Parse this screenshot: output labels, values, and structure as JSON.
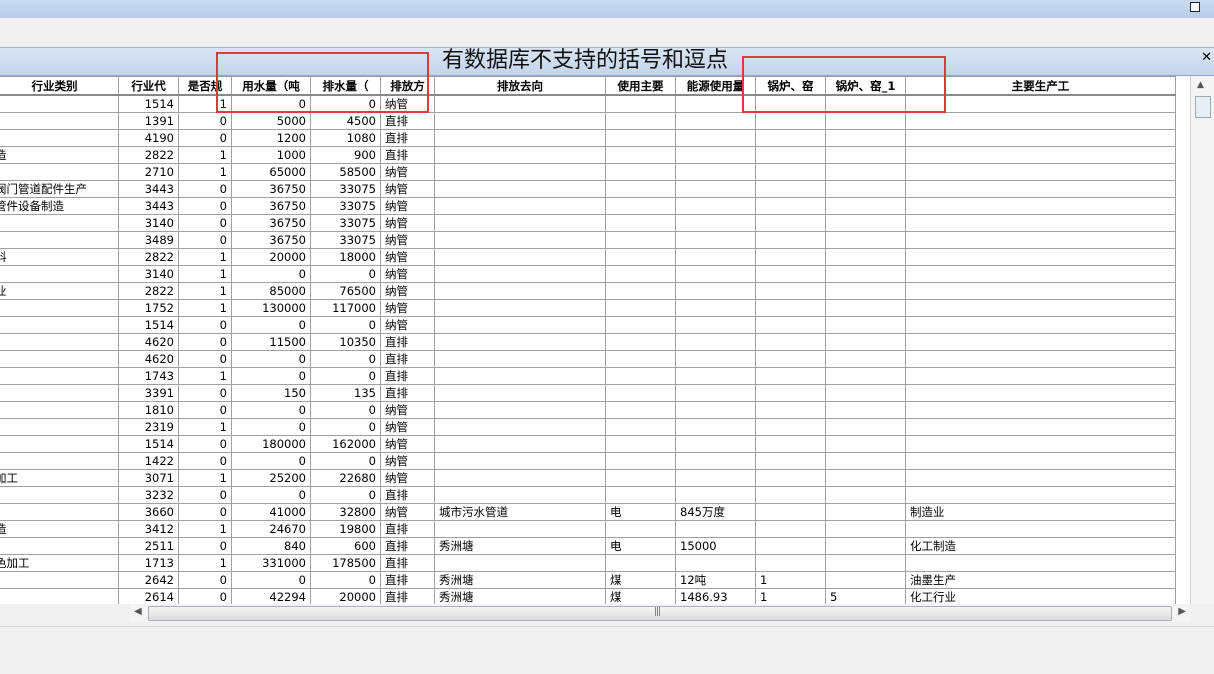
{
  "window": {
    "title": "有数据库不支持的括号和逗点"
  },
  "columns": [
    "行业类别",
    "行业代",
    "是否规",
    "用水量（吨",
    "排水量（",
    "排放方",
    "排放去向",
    "使用主要",
    "能源使用量",
    "锅炉、窑",
    "锅炉、窑_1",
    "主要生产工"
  ],
  "rows": [
    [
      "",
      "1514",
      "1",
      "0",
      "0",
      "纳管",
      "",
      "",
      "",
      "",
      "",
      ""
    ],
    [
      "",
      "1391",
      "0",
      "5000",
      "4500",
      "直排",
      "",
      "",
      "",
      "",
      "",
      ""
    ],
    [
      "",
      "4190",
      "0",
      "1200",
      "1080",
      "直排",
      "",
      "",
      "",
      "",
      "",
      ""
    ],
    [
      "造",
      "2822",
      "1",
      "1000",
      "900",
      "直排",
      "",
      "",
      "",
      "",
      "",
      ""
    ],
    [
      "",
      "2710",
      "1",
      "65000",
      "58500",
      "纳管",
      "",
      "",
      "",
      "",
      "",
      ""
    ],
    [
      "阀门管道配件生产",
      "3443",
      "0",
      "36750",
      "33075",
      "纳管",
      "",
      "",
      "",
      "",
      "",
      ""
    ],
    [
      "管件设备制造",
      "3443",
      "0",
      "36750",
      "33075",
      "纳管",
      "",
      "",
      "",
      "",
      "",
      ""
    ],
    [
      "",
      "3140",
      "0",
      "36750",
      "33075",
      "纳管",
      "",
      "",
      "",
      "",
      "",
      ""
    ],
    [
      "",
      "3489",
      "0",
      "36750",
      "33075",
      "纳管",
      "",
      "",
      "",
      "",
      "",
      ""
    ],
    [
      "料",
      "2822",
      "1",
      "20000",
      "18000",
      "纳管",
      "",
      "",
      "",
      "",
      "",
      ""
    ],
    [
      "",
      "3140",
      "1",
      "0",
      "0",
      "纳管",
      "",
      "",
      "",
      "",
      "",
      ""
    ],
    [
      "业",
      "2822",
      "1",
      "85000",
      "76500",
      "纳管",
      "",
      "",
      "",
      "",
      "",
      ""
    ],
    [
      "",
      "1752",
      "1",
      "130000",
      "117000",
      "纳管",
      "",
      "",
      "",
      "",
      "",
      ""
    ],
    [
      "",
      "1514",
      "0",
      "0",
      "0",
      "纳管",
      "",
      "",
      "",
      "",
      "",
      ""
    ],
    [
      "",
      "4620",
      "0",
      "11500",
      "10350",
      "直排",
      "",
      "",
      "",
      "",
      "",
      ""
    ],
    [
      "",
      "4620",
      "0",
      "0",
      "0",
      "直排",
      "",
      "",
      "",
      "",
      "",
      ""
    ],
    [
      "",
      "1743",
      "1",
      "0",
      "0",
      "直排",
      "",
      "",
      "",
      "",
      "",
      ""
    ],
    [
      "",
      "3391",
      "0",
      "150",
      "135",
      "直排",
      "",
      "",
      "",
      "",
      "",
      ""
    ],
    [
      "",
      "1810",
      "0",
      "0",
      "0",
      "纳管",
      "",
      "",
      "",
      "",
      "",
      ""
    ],
    [
      "",
      "2319",
      "1",
      "0",
      "0",
      "纳管",
      "",
      "",
      "",
      "",
      "",
      ""
    ],
    [
      "",
      "1514",
      "0",
      "180000",
      "162000",
      "纳管",
      "",
      "",
      "",
      "",
      "",
      ""
    ],
    [
      "",
      "1422",
      "0",
      "0",
      "0",
      "纳管",
      "",
      "",
      "",
      "",
      "",
      ""
    ],
    [
      "加工",
      "3071",
      "1",
      "25200",
      "22680",
      "纳管",
      "",
      "",
      "",
      "",
      "",
      ""
    ],
    [
      "",
      "3232",
      "0",
      "0",
      "0",
      "直排",
      "",
      "",
      "",
      "",
      "",
      ""
    ],
    [
      "",
      "3660",
      "0",
      "41000",
      "32800",
      "纳管",
      "城市污水管道",
      "电",
      "845万度",
      "",
      "",
      "制造业"
    ],
    [
      "造",
      "3412",
      "1",
      "24670",
      "19800",
      "直排",
      "",
      "",
      "",
      "",
      "",
      ""
    ],
    [
      "",
      "2511",
      "0",
      "840",
      "600",
      "直排",
      "秀洲塘",
      "电",
      "15000",
      "",
      "",
      "化工制造"
    ],
    [
      "色加工",
      "1713",
      "1",
      "331000",
      "178500",
      "直排",
      "",
      "",
      "",
      "",
      "",
      ""
    ],
    [
      "",
      "2642",
      "0",
      "0",
      "0",
      "直排",
      "秀洲塘",
      "煤",
      "12吨",
      "1",
      "",
      "油墨生产"
    ],
    [
      "",
      "2614",
      "0",
      "42294",
      "20000",
      "直排",
      "秀洲塘",
      "煤",
      "1486.93",
      "1",
      "5",
      "化工行业"
    ]
  ]
}
